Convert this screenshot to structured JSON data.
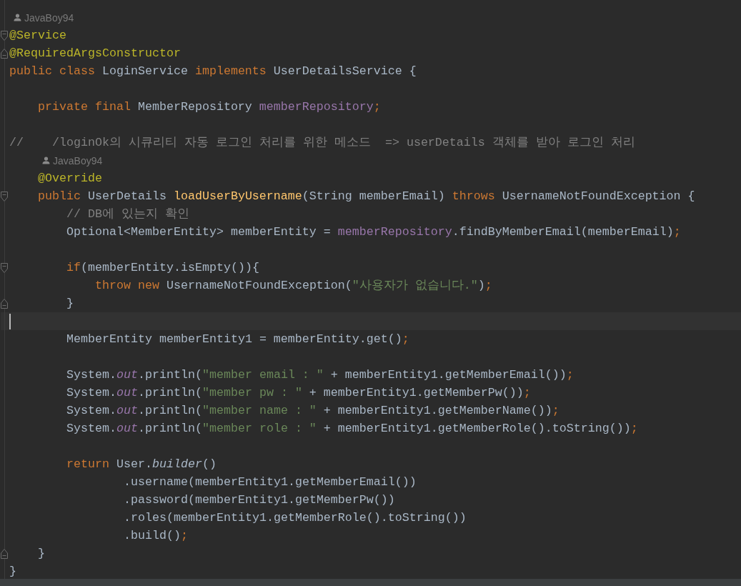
{
  "editor": {
    "lines": [
      {
        "kind": "author",
        "text": "JavaBoy94"
      },
      {
        "kind": "code",
        "gutter_icon": {
          "kind": "fold_start"
        },
        "segments": [
          {
            "kind": "annotation",
            "text": "@Service"
          }
        ]
      },
      {
        "kind": "code",
        "gutter_icon": {
          "kind": "fold_end"
        },
        "segments": [
          {
            "kind": "annotation",
            "text": "@RequiredArgsConstructor"
          }
        ]
      },
      {
        "kind": "code",
        "segments": [
          {
            "kind": "keyword",
            "text": "public class "
          },
          {
            "kind": "plain",
            "text": "LoginService "
          },
          {
            "kind": "keyword",
            "text": "implements "
          },
          {
            "kind": "plain",
            "text": "UserDetailsService {"
          }
        ]
      },
      {
        "kind": "blank"
      },
      {
        "kind": "code",
        "segments": [
          {
            "kind": "keyword",
            "text": "    private final "
          },
          {
            "kind": "plain",
            "text": "MemberRepository "
          },
          {
            "kind": "field",
            "text": "memberRepository"
          },
          {
            "kind": "keyword",
            "text": ";"
          }
        ]
      },
      {
        "kind": "blank"
      },
      {
        "kind": "code",
        "segments": [
          {
            "kind": "comment",
            "text": "//    /loginOk의 시큐리티 자동 로그인 처리를 위한 메소드  => userDetails 객체를 받아 로그인 처리"
          }
        ]
      },
      {
        "kind": "author",
        "text": "    JavaBoy94"
      },
      {
        "kind": "code",
        "segments": [
          {
            "kind": "annotation",
            "text": "    @Override"
          }
        ]
      },
      {
        "kind": "code",
        "gutter_icon": {
          "kind": "fold_start"
        },
        "segments": [
          {
            "kind": "keyword",
            "text": "    public "
          },
          {
            "kind": "plain",
            "text": "UserDetails "
          },
          {
            "kind": "method",
            "text": "loadUserByUsername"
          },
          {
            "kind": "plain",
            "text": "(String memberEmail) "
          },
          {
            "kind": "keyword",
            "text": "throws "
          },
          {
            "kind": "plain",
            "text": "UsernameNotFoundException {"
          }
        ]
      },
      {
        "kind": "code",
        "segments": [
          {
            "kind": "comment",
            "text": "        // DB에 있는지 확인"
          }
        ]
      },
      {
        "kind": "code",
        "segments": [
          {
            "kind": "plain",
            "text": "        Optional<MemberEntity> memberEntity = "
          },
          {
            "kind": "field",
            "text": "memberRepository"
          },
          {
            "kind": "plain",
            "text": ".findByMemberEmail(memberEmail)"
          },
          {
            "kind": "keyword",
            "text": ";"
          }
        ]
      },
      {
        "kind": "blank"
      },
      {
        "kind": "code",
        "gutter_icon": {
          "kind": "fold_start"
        },
        "segments": [
          {
            "kind": "keyword",
            "text": "        if"
          },
          {
            "kind": "plain",
            "text": "(memberEntity.isEmpty()){"
          }
        ]
      },
      {
        "kind": "code",
        "segments": [
          {
            "kind": "keyword",
            "text": "            throw new "
          },
          {
            "kind": "plain",
            "text": "UsernameNotFoundException("
          },
          {
            "kind": "string",
            "text": "\"사용자가 없습니다.\""
          },
          {
            "kind": "plain",
            "text": ")"
          },
          {
            "kind": "keyword",
            "text": ";"
          }
        ]
      },
      {
        "kind": "code",
        "gutter_icon": {
          "kind": "fold_end"
        },
        "segments": [
          {
            "kind": "plain",
            "text": "        }"
          }
        ]
      },
      {
        "kind": "blank",
        "current": true
      },
      {
        "kind": "code",
        "segments": [
          {
            "kind": "plain",
            "text": "        MemberEntity memberEntity1 = memberEntity.get()"
          },
          {
            "kind": "keyword",
            "text": ";"
          }
        ]
      },
      {
        "kind": "blank"
      },
      {
        "kind": "code",
        "segments": [
          {
            "kind": "plain",
            "text": "        System."
          },
          {
            "kind": "static_field",
            "text": "out"
          },
          {
            "kind": "plain",
            "text": ".println("
          },
          {
            "kind": "string",
            "text": "\"member email : \""
          },
          {
            "kind": "plain",
            "text": " + memberEntity1.getMemberEmail())"
          },
          {
            "kind": "keyword",
            "text": ";"
          }
        ]
      },
      {
        "kind": "code",
        "segments": [
          {
            "kind": "plain",
            "text": "        System."
          },
          {
            "kind": "static_field",
            "text": "out"
          },
          {
            "kind": "plain",
            "text": ".println("
          },
          {
            "kind": "string",
            "text": "\"member pw : \""
          },
          {
            "kind": "plain",
            "text": " + memberEntity1.getMemberPw())"
          },
          {
            "kind": "keyword",
            "text": ";"
          }
        ]
      },
      {
        "kind": "code",
        "segments": [
          {
            "kind": "plain",
            "text": "        System."
          },
          {
            "kind": "static_field",
            "text": "out"
          },
          {
            "kind": "plain",
            "text": ".println("
          },
          {
            "kind": "string",
            "text": "\"member name : \""
          },
          {
            "kind": "plain",
            "text": " + memberEntity1.getMemberName())"
          },
          {
            "kind": "keyword",
            "text": ";"
          }
        ]
      },
      {
        "kind": "code",
        "segments": [
          {
            "kind": "plain",
            "text": "        System."
          },
          {
            "kind": "static_field",
            "text": "out"
          },
          {
            "kind": "plain",
            "text": ".println("
          },
          {
            "kind": "string",
            "text": "\"member role : \""
          },
          {
            "kind": "plain",
            "text": " + memberEntity1.getMemberRole().toString())"
          },
          {
            "kind": "keyword",
            "text": ";"
          }
        ]
      },
      {
        "kind": "blank"
      },
      {
        "kind": "code",
        "segments": [
          {
            "kind": "keyword",
            "text": "        return "
          },
          {
            "kind": "plain",
            "text": "User."
          },
          {
            "kind": "static_call",
            "text": "builder"
          },
          {
            "kind": "plain",
            "text": "()"
          }
        ]
      },
      {
        "kind": "code",
        "segments": [
          {
            "kind": "plain",
            "text": "                .username(memberEntity1.getMemberEmail())"
          }
        ]
      },
      {
        "kind": "code",
        "segments": [
          {
            "kind": "plain",
            "text": "                .password(memberEntity1.getMemberPw())"
          }
        ]
      },
      {
        "kind": "code",
        "segments": [
          {
            "kind": "plain",
            "text": "                .roles(memberEntity1.getMemberRole().toString())"
          }
        ]
      },
      {
        "kind": "code",
        "segments": [
          {
            "kind": "plain",
            "text": "                .build()"
          },
          {
            "kind": "keyword",
            "text": ";"
          }
        ]
      },
      {
        "kind": "code",
        "gutter_icon": {
          "kind": "fold_end"
        },
        "segments": [
          {
            "kind": "plain",
            "text": "    }"
          }
        ]
      },
      {
        "kind": "code",
        "segments": [
          {
            "kind": "plain",
            "text": "}"
          }
        ]
      }
    ]
  }
}
